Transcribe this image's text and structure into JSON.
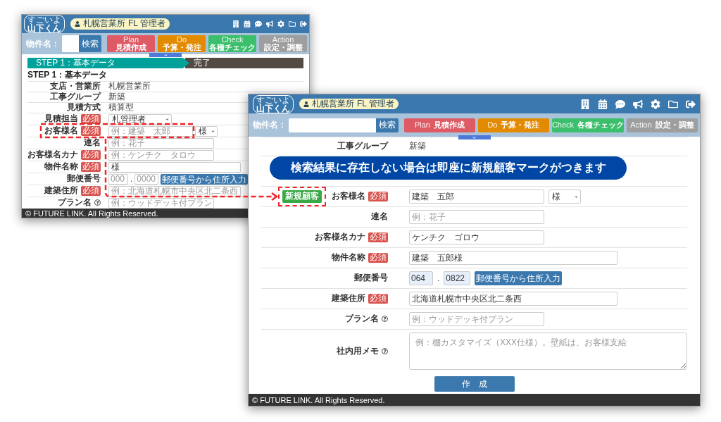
{
  "back_window": {
    "header": {
      "logo": [
        "すごいよ",
        "山下くん"
      ],
      "user": {
        "office": "札幌営業所",
        "role": "FL 管理者"
      }
    },
    "toolbar": {
      "search_label": "物件名：",
      "search_button": "検索",
      "phases": [
        {
          "name": "Plan",
          "label": "見積作成",
          "color": "#de5b66"
        },
        {
          "name": "Do",
          "label": "予算・発注",
          "color": "#e38b00"
        },
        {
          "name": "Check",
          "label": "各種チェック",
          "color": "#3cbf6c"
        },
        {
          "name": "Action",
          "label": "設定・調整",
          "color": "#9e9e9e"
        }
      ]
    },
    "steps": [
      {
        "label": "STEP 1：基本データ",
        "selected": true
      },
      {
        "label": "完了",
        "selected": false
      }
    ],
    "heading": "STEP 1：基本データ",
    "rows": [
      {
        "label": "支店・営業所",
        "kind": "static",
        "value": "札幌営業所",
        "help": false
      },
      {
        "label": "工事グループ",
        "kind": "static",
        "value": "新築",
        "help": false
      },
      {
        "label": "見積方式",
        "kind": "static",
        "value": "積算型",
        "help": false
      },
      {
        "label": "見積担当",
        "badge": "必須",
        "kind": "select",
        "value": "札管理者",
        "help": false
      },
      {
        "label": "お客様名",
        "badge": "必須",
        "kind": "name",
        "placeholder": "例：建築　太郎",
        "honorific": "様",
        "help": false
      },
      {
        "label": "連名",
        "kind": "input",
        "placeholder": "例：花子",
        "help": false
      },
      {
        "label": "お客様名カナ",
        "badge": "必須",
        "kind": "input",
        "placeholder": "例：ケンチク　タロウ",
        "help": false
      },
      {
        "label": "物件名称",
        "badge": "必須",
        "kind": "input_long",
        "value": "様",
        "help": false
      },
      {
        "label": "郵便番号",
        "kind": "postal",
        "parts": [
          {
            "placeholder": "000"
          },
          {
            "placeholder": "0000"
          }
        ],
        "separator": ".",
        "button": "郵便番号から住所入力",
        "help": false
      },
      {
        "label": "建築住所",
        "badge": "必須",
        "kind": "input_long",
        "placeholder": "例：北海道札幌市中央区北二条西",
        "help": false
      },
      {
        "label": "プラン名",
        "kind": "input",
        "placeholder": "例：ウッドデッキ付プラン",
        "help": true
      }
    ],
    "footer": "© FUTURE LINK. All Rights Reserved."
  },
  "front_window": {
    "header": {
      "logo": [
        "すごいよ",
        "山下くん"
      ],
      "user": {
        "office": "札幌営業所",
        "role": "FL 管理者"
      }
    },
    "toolbar": {
      "search_label": "物件名：",
      "search_button": "検索",
      "phases": [
        {
          "name": "Plan",
          "label": "見積作成",
          "color": "#de5b66"
        },
        {
          "name": "Do",
          "label": "予算・発注",
          "color": "#e38b00"
        },
        {
          "name": "Check",
          "label": "各種チェック",
          "color": "#3cbf6c"
        },
        {
          "name": "Action",
          "label": "設定・調整",
          "color": "#9e9e9e"
        }
      ]
    },
    "rows": [
      {
        "label": "工事グループ",
        "kind": "static",
        "value": "新築",
        "help": false
      },
      {
        "label": "お客様名",
        "new_badge": "新規顧客",
        "badge": "必須",
        "kind": "name",
        "value": "建築　五郎",
        "honorific": "様",
        "help": false
      },
      {
        "label": "連名",
        "kind": "input",
        "placeholder": "例：花子",
        "help": false
      },
      {
        "label": "お客様名カナ",
        "badge": "必須",
        "kind": "input",
        "value": "ケンチク　ゴロウ",
        "help": false
      },
      {
        "label": "物件名称",
        "badge": "必須",
        "kind": "input_long",
        "value": "建築　五郎様",
        "help": false
      },
      {
        "label": "郵便番号",
        "kind": "postal",
        "parts": [
          {
            "value": "064"
          },
          {
            "value": "0822"
          }
        ],
        "separator": ".",
        "button": "郵便番号から住所入力",
        "help": false
      },
      {
        "label": "建築住所",
        "badge": "必須",
        "kind": "input_long",
        "value": "北海道札幌市中央区北二条西",
        "help": false
      },
      {
        "label": "プラン名",
        "kind": "input",
        "placeholder": "例：ウッドデッキ付プラン",
        "help": true
      },
      {
        "label": "社内用メモ",
        "kind": "textarea",
        "placeholder": "例：棚カスタマイズ（XXX仕様）。壁紙は、お客様支給",
        "help": true
      }
    ],
    "submit": "作　成",
    "footer": "© FUTURE LINK. All Rights Reserved."
  },
  "callout": "検索結果に存在しない場合は即座に新規顧客マークがつきます"
}
